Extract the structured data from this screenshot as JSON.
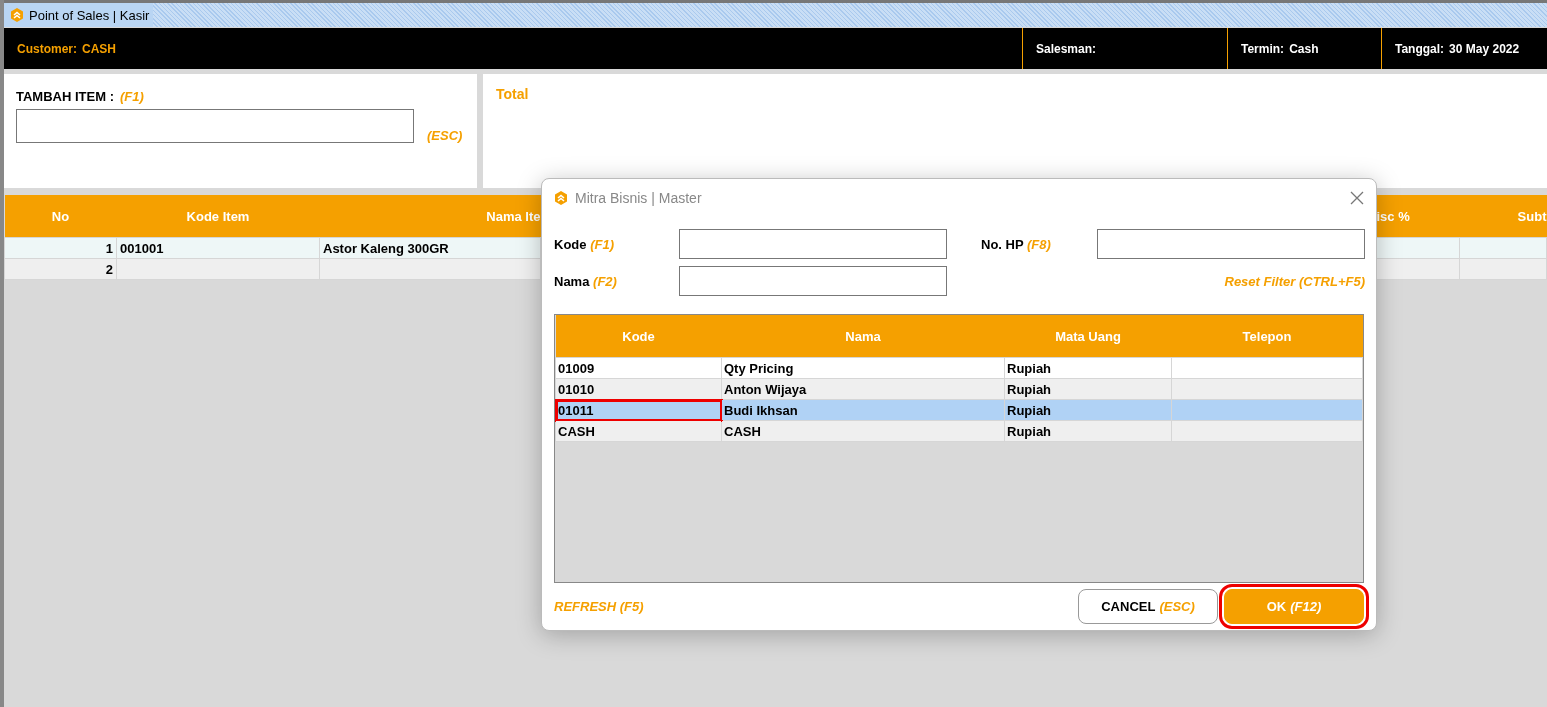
{
  "window": {
    "title": "Point of Sales | Kasir"
  },
  "header": {
    "customer": {
      "label": "Customer:",
      "value": "CASH"
    },
    "fields": [
      {
        "label": "Salesman:"
      },
      {
        "label": "Termin:",
        "value": "Cash"
      },
      {
        "label": "Tanggal:",
        "value": "30 May 2022"
      }
    ]
  },
  "add_item": {
    "label": "TAMBAH ITEM :",
    "shortcut": "(F1)",
    "escape_hint": "(ESC)"
  },
  "total": {
    "label": "Total"
  },
  "items_table": {
    "columns": [
      "No",
      "Kode Item",
      "Nama Ite",
      "isc %",
      "Subt"
    ],
    "rows": [
      {
        "no": "1",
        "kode": "001001",
        "nama": "Astor Kaleng 300GR"
      },
      {
        "no": "2",
        "kode": "",
        "nama": ""
      }
    ]
  },
  "dialog": {
    "title": "Mitra Bisnis | Master",
    "filters": [
      {
        "label": "Kode",
        "shortcut": "(F1)"
      },
      {
        "label": "No. HP",
        "shortcut": "(F8)"
      },
      {
        "label": "Nama",
        "shortcut": "(F2)"
      }
    ],
    "reset_link": "Reset Filter (CTRL+F5)",
    "table": {
      "columns": [
        "Kode",
        "Nama",
        "Mata Uang",
        "Telepon"
      ],
      "rows": [
        {
          "cells": [
            "01009",
            "Qty Pricing",
            "Rupiah",
            ""
          ],
          "selected": false,
          "highlighted": false
        },
        {
          "cells": [
            "01010",
            "Anton Wijaya",
            "Rupiah",
            ""
          ],
          "selected": false,
          "highlighted": false
        },
        {
          "cells": [
            "01011",
            "Budi Ikhsan",
            "Rupiah",
            ""
          ],
          "selected": true,
          "highlighted": true
        },
        {
          "cells": [
            "CASH",
            "CASH",
            "Rupiah",
            ""
          ],
          "selected": false,
          "highlighted": false
        }
      ]
    },
    "refresh_link": "REFRESH (F5)",
    "buttons": [
      {
        "kind": "secondary",
        "label": "CANCEL",
        "shortcut": "(ESC)",
        "highlighted": false
      },
      {
        "kind": "primary",
        "label": "OK",
        "shortcut": "(F12)",
        "highlighted": true
      }
    ]
  }
}
